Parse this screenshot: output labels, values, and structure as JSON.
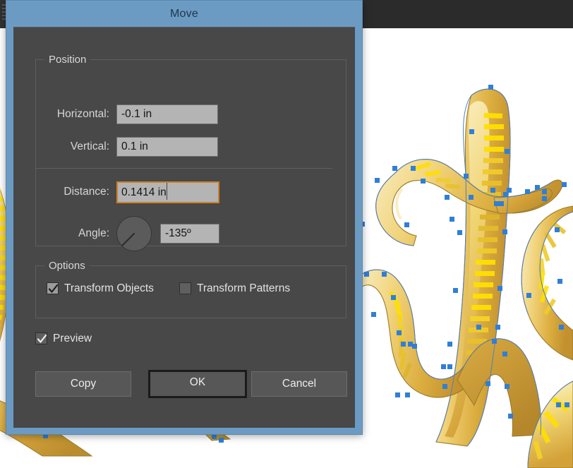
{
  "app": {
    "background_color": "#2b2b2b",
    "canvas_color": "#ffffff"
  },
  "dialog": {
    "title": "Move",
    "titlebar_color": "#6b9bc3",
    "body_color": "#484848",
    "focus_color": "#cd8129",
    "position_group": {
      "legend": "Position",
      "fields": [
        {
          "label": "Horizontal:",
          "value": "-0.1 in",
          "focused": false
        },
        {
          "label": "Vertical:",
          "value": "0.1 in",
          "focused": false
        },
        {
          "label": "Distance:",
          "value": "0.1414 in",
          "focused": true
        },
        {
          "label": "Angle:",
          "value": "-135º",
          "focused": false
        }
      ],
      "angle_dial": {
        "name": "angle-dial",
        "degrees": -135
      }
    },
    "options_group": {
      "legend": "Options",
      "checkboxes": [
        {
          "label": "Transform Objects",
          "checked": true
        },
        {
          "label": "Transform Patterns",
          "checked": false
        }
      ]
    },
    "preview": {
      "label": "Preview",
      "checked": true
    },
    "buttons": [
      {
        "label": "Copy",
        "default": false
      },
      {
        "label": "OK",
        "default": true
      },
      {
        "label": "Cancel",
        "default": false
      }
    ]
  },
  "artwork": {
    "description": "Gold calligraphic lettering artwork with selected vector paths",
    "selection_color": "#2f7fd8",
    "fill_colors": [
      "#f2cc4b",
      "#e8b93c",
      "#d2a038",
      "#f7e27a",
      "#ffe000",
      "#c89a34"
    ]
  }
}
